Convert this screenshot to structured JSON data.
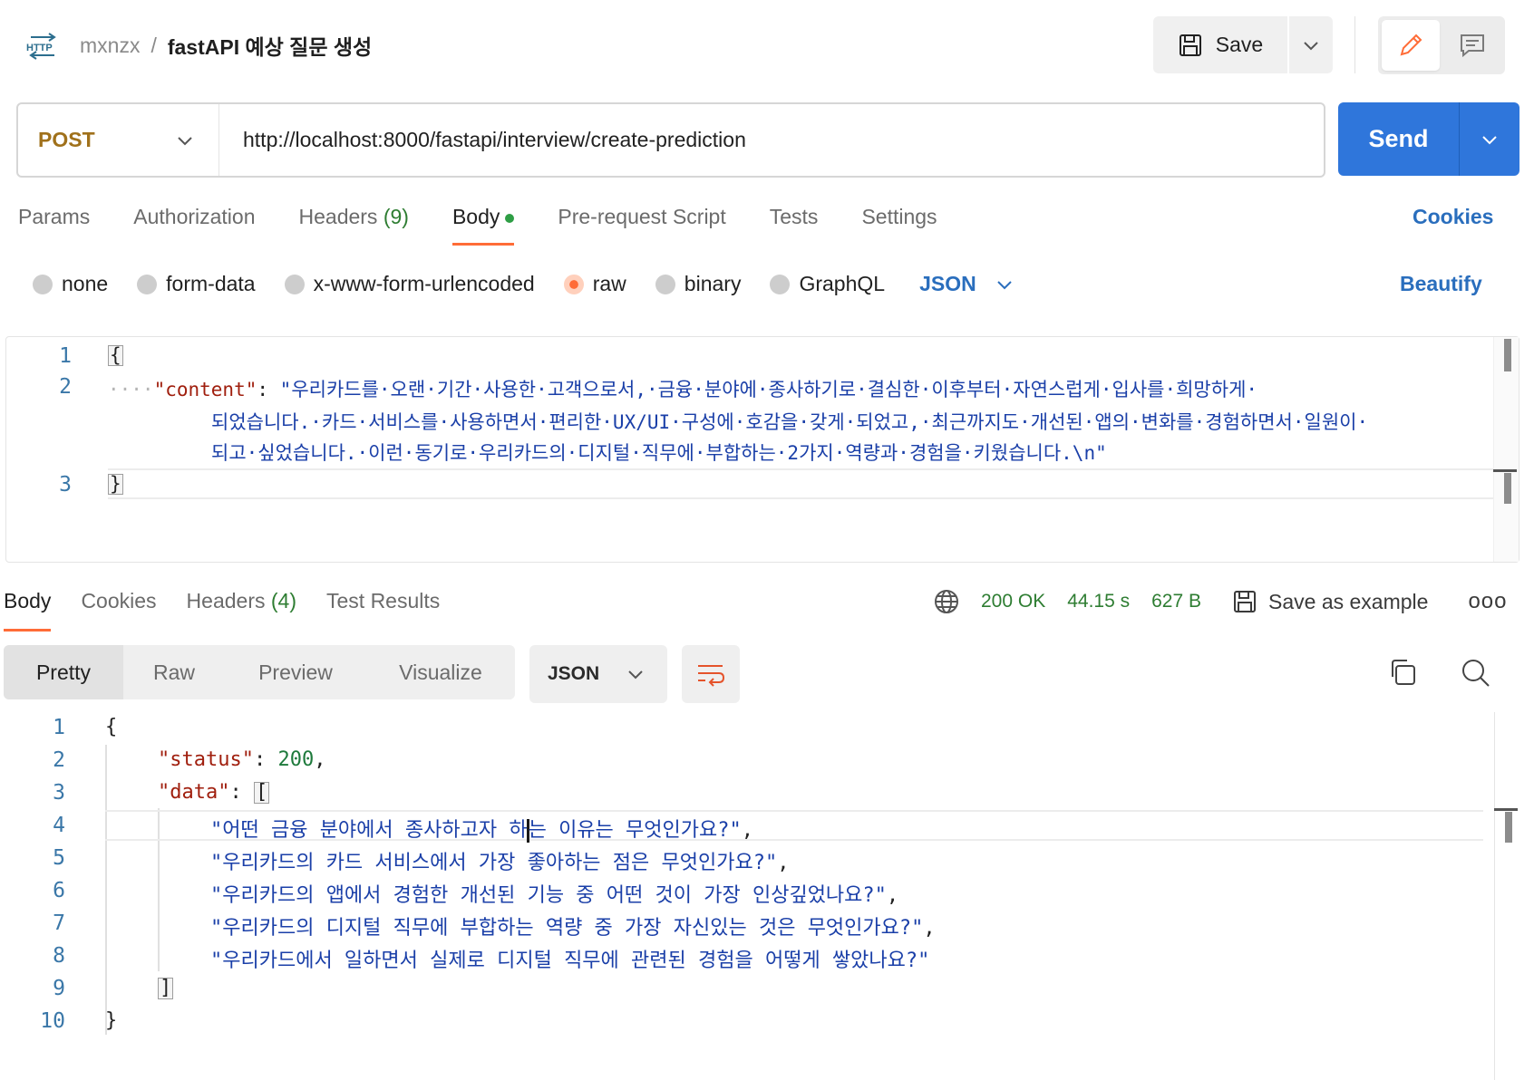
{
  "header": {
    "request_type_icon": "http-icon",
    "workspace": "mxnzx",
    "separator": "/",
    "request_name": "fastAPI 예상 질문 생성",
    "save_label": "Save"
  },
  "url_bar": {
    "method": "POST",
    "url": "http://localhost:8000/fastapi/interview/create-prediction",
    "send_label": "Send"
  },
  "request_tabs": [
    {
      "label": "Params"
    },
    {
      "label": "Authorization"
    },
    {
      "label": "Headers",
      "count": "(9)"
    },
    {
      "label": "Body",
      "active": true,
      "dot": true
    },
    {
      "label": "Pre-request Script"
    },
    {
      "label": "Tests"
    },
    {
      "label": "Settings"
    }
  ],
  "cookies_link": "Cookies",
  "body_types": {
    "options": [
      "none",
      "form-data",
      "x-www-form-urlencoded",
      "raw",
      "binary",
      "GraphQL"
    ],
    "selected": "raw",
    "format": "JSON",
    "beautify_label": "Beautify"
  },
  "request_body": {
    "line_numbers": [
      "1",
      "2",
      "3"
    ],
    "open_brace": "{",
    "close_brace": "}",
    "key": "\"content\"",
    "colon": ": ",
    "value_line1": "\"우리카드를·오랜·기간·사용한·고객으로서,·금융·분야에·종사하기로·결심한·이후부터·자연스럽게·입사를·희망하게·",
    "value_line2": "되었습니다.·카드·서비스를·사용하면서·편리한·UX/UI·구성에·호감을·갖게·되었고,·최근까지도·개선된·앱의·변화를·경험하면서·일원이·",
    "value_line3": "되고·싶었습니다.·이런·동기로·우리카드의·디지털·직무에·부합하는·2가지·역량과·경험을·키웠습니다.\\n\"",
    "indent_dots": "····"
  },
  "response_tabs": [
    {
      "label": "Body",
      "active": true
    },
    {
      "label": "Cookies"
    },
    {
      "label": "Headers",
      "count": "(4)"
    },
    {
      "label": "Test Results"
    }
  ],
  "response_meta": {
    "status": "200 OK",
    "time": "44.15 s",
    "size": "627 B",
    "save_example_label": "Save as example",
    "more": "ooo"
  },
  "view_modes": [
    {
      "label": "Pretty",
      "active": true
    },
    {
      "label": "Raw"
    },
    {
      "label": "Preview"
    },
    {
      "label": "Visualize"
    }
  ],
  "response_format": "JSON",
  "response_body": {
    "line_numbers": [
      "1",
      "2",
      "3",
      "4",
      "5",
      "6",
      "7",
      "8",
      "9",
      "10"
    ],
    "open_brace": "{",
    "status_key": "\"status\"",
    "status_value": "200",
    "data_key": "\"data\"",
    "open_bracket": "[",
    "items": [
      "\"어떤 금융 분야에서 종사하고자 하는 이유는 무엇인가요?\"",
      "\"우리카드의 카드 서비스에서 가장 좋아하는 점은 무엇인가요?\"",
      "\"우리카드의 앱에서 경험한 개선된 기능 중 어떤 것이 가장 인상깊었나요?\"",
      "\"우리카드의 디지털 직무에 부합하는 역량 중 가장 자신있는 것은 무엇인가요?\"",
      "\"우리카드에서 일하면서 실제로 디지털 직무에 관련된 경험을 어떻게 쌓았나요?\""
    ],
    "item4_part1": "\"어떤 금융 분야에서 종사하고자 하",
    "item4_part2": "는 이유는 무엇인가요?\"",
    "close_bracket": "]",
    "close_brace": "}"
  },
  "colors": {
    "accent": "#ff6c37",
    "send": "#2f76db",
    "method": "#a0711b",
    "link": "#2a6ebd",
    "status_ok": "#2e7d32"
  }
}
